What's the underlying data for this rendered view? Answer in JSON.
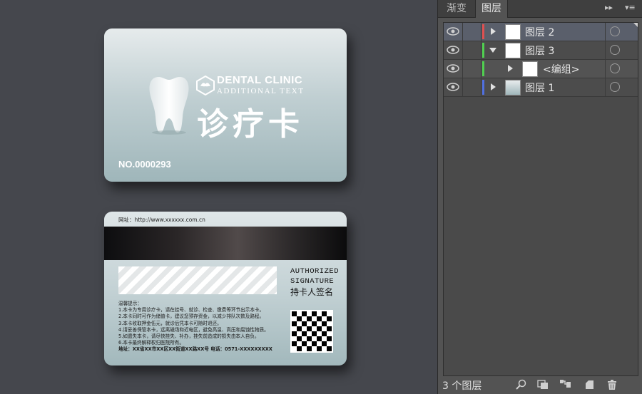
{
  "front_card": {
    "brand": "DENTAL CLINIC",
    "brand_sub": "ADDITIONAL TEXT",
    "title": "诊疗卡",
    "number": "NO.0000293"
  },
  "back_card": {
    "website": "网址：http://www.xxxxxx.com.cn",
    "auth_line1": "AUTHORIZED",
    "auth_line2": "SIGNATURE",
    "holder_sig": "持卡人签名",
    "notice_title": "温馨提示：",
    "notice_lines": [
      "1.本卡为专用诊疗卡，请在挂号、就诊、检查、缴费等环节出示本卡。",
      "2.本卡同时可作为储值卡，建议您预存资金，以减少排队次数及路程。",
      "3.本卡收取押金伍元，就诊后凭本卡可随时退还。",
      "4.请妥善保管本卡，远离磁场和近电区，避免高温、高压和腐蚀性物质。",
      "5.如遗失本卡，请尽快挂失、补办，挂失前造成的损失由本人自负。",
      "6.本卡最终解释权归医院所有。"
    ],
    "address": "地址：XX省XX市XX区XX街道XX路XX号    电话：0571-XXXXXXXXX"
  },
  "panel": {
    "tabs": [
      {
        "label": "渐变",
        "active": false
      },
      {
        "label": "图层",
        "active": true
      }
    ],
    "collapse_glyph": "▸▸",
    "menu_glyph": "▾≡",
    "layers": [
      {
        "name": "图层 2",
        "color": "#e05050",
        "expanded": false,
        "selected": true
      },
      {
        "name": "图层 3",
        "color": "#50d050",
        "expanded": true,
        "selected": false
      },
      {
        "name": "<编组>",
        "color": "#50d050",
        "expanded": false,
        "selected": false
      },
      {
        "name": "图层 1",
        "color": "#5070e0",
        "expanded": false,
        "selected": false
      }
    ],
    "layer_count": "3 个图层",
    "footer_icons": [
      "search-icon",
      "clip-mask-icon",
      "sublayer-icon",
      "new-layer-icon",
      "trash-icon"
    ]
  }
}
